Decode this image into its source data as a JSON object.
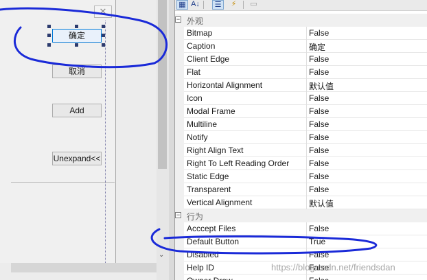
{
  "dialog": {
    "close_glyph": "✕",
    "buttons": {
      "ok": "确定",
      "cancel": "取消",
      "add": "Add",
      "unexpand": "Unexpand<<"
    }
  },
  "toolbar": {
    "icons": [
      "categorized-icon",
      "alphabetical-icon",
      "properties-icon",
      "events-icon",
      "property-pages-icon"
    ],
    "categorized_glyph": "▦",
    "alphabetical_glyph": "A↓",
    "properties_glyph": "☰",
    "events_glyph": "⚡",
    "pages_glyph": "▭"
  },
  "property_grid": {
    "categories": {
      "appearance": {
        "label": "外观",
        "toggle": "⊟"
      },
      "behavior": {
        "label": "行为",
        "toggle": "⊟"
      }
    },
    "appearance_props": [
      {
        "name": "Bitmap",
        "value": "False"
      },
      {
        "name": "Caption",
        "value": "确定"
      },
      {
        "name": "Client Edge",
        "value": "False"
      },
      {
        "name": "Flat",
        "value": "False"
      },
      {
        "name": "Horizontal Alignment",
        "value": "默认值"
      },
      {
        "name": "Icon",
        "value": "False"
      },
      {
        "name": "Modal Frame",
        "value": "False"
      },
      {
        "name": "Multiline",
        "value": "False"
      },
      {
        "name": "Notify",
        "value": "False"
      },
      {
        "name": "Right Align Text",
        "value": "False"
      },
      {
        "name": "Right To Left Reading Order",
        "value": "False"
      },
      {
        "name": "Static Edge",
        "value": "False"
      },
      {
        "name": "Transparent",
        "value": "False"
      },
      {
        "name": "Vertical Alignment",
        "value": "默认值"
      }
    ],
    "behavior_props": [
      {
        "name": "Acccept Files",
        "value": "False"
      },
      {
        "name": "Default Button",
        "value": "True"
      },
      {
        "name": "Disabled",
        "value": "False"
      },
      {
        "name": "Help ID",
        "value": "False"
      },
      {
        "name": "Owner Draw",
        "value": "False"
      }
    ]
  },
  "watermark": "https://blog.csdn.net/friendsdan",
  "colors": {
    "annotation_ink": "#1a2ad8",
    "selection_border": "#0078d7",
    "handle": "#2c3b6e"
  }
}
